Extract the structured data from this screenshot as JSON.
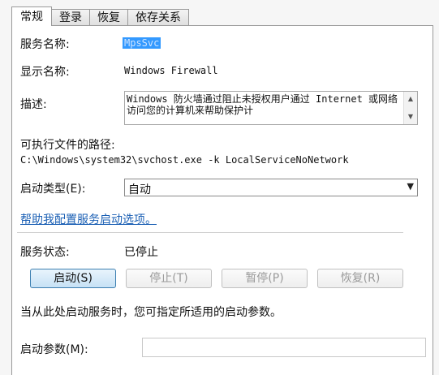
{
  "tabs": [
    {
      "label": "常规",
      "active": true
    },
    {
      "label": "登录",
      "active": false
    },
    {
      "label": "恢复",
      "active": false
    },
    {
      "label": "依存关系",
      "active": false
    }
  ],
  "general": {
    "service_name_label": "服务名称:",
    "service_name_value": "MpsSvc",
    "display_name_label": "显示名称:",
    "display_name_value": "Windows Firewall",
    "description_label": "描述:",
    "description_value": "Windows 防火墙通过阻止未授权用户通过 Internet 或网络访问您的计算机来帮助保护计",
    "exe_path_label": "可执行文件的路径:",
    "exe_path_value": "C:\\Windows\\system32\\svchost.exe -k LocalServiceNoNetwork",
    "startup_type_label": "启动类型(E):",
    "startup_type_value": "自动",
    "help_link": "帮助我配置服务启动选项。",
    "service_status_label": "服务状态:",
    "service_status_value": "已停止",
    "buttons": {
      "start": "启动(S)",
      "stop": "停止(T)",
      "pause": "暂停(P)",
      "resume": "恢复(R)"
    },
    "hint": "当从此处启动服务时，您可指定所适用的启动参数。",
    "start_params_label": "启动参数(M):",
    "start_params_value": ""
  },
  "colors": {
    "selection": "#3399ff",
    "link": "#1a5fb4",
    "primary_button_border": "#3c7fb1"
  },
  "icons": {
    "scroll_up": "scroll-up-arrow-icon",
    "scroll_down": "scroll-down-arrow-icon",
    "dropdown": "chevron-down-icon"
  }
}
